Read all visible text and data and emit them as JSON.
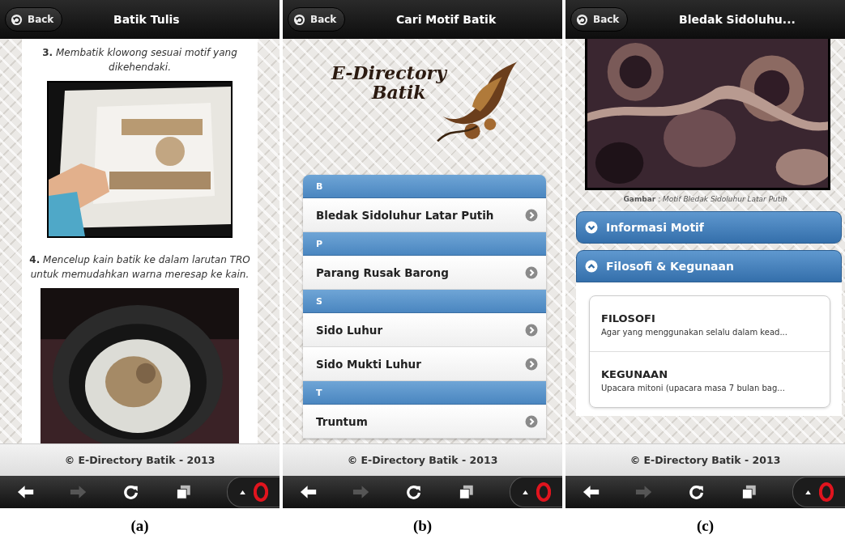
{
  "screens": [
    {
      "kind": "steps",
      "header": {
        "back": "Back",
        "title": "Batik Tulis"
      },
      "steps": [
        {
          "text": "**3.** *Membatik klowong sesuai motif yang dikehendaki.*",
          "picture": {
            "kind": "picture"
          }
        },
        {
          "text": "**4.** *Mencelup kain batik ke dalam larutan TRO untuk memudahkan warna meresap ke kain.*",
          "picture": {
            "kind": "picture"
          }
        }
      ],
      "footer": "© E-Directory Batik - 2013",
      "browser_bar": {
        "forward_disabled": true
      },
      "caption": "(a)"
    },
    {
      "kind": "list",
      "header": {
        "back": "Back",
        "title": "Cari Motif Batik"
      },
      "logo": {
        "line_1": "E-Directory",
        "line_2": "Batik"
      },
      "groups": [
        {
          "letter": "B",
          "items": [
            "Bledak Sidoluhur Latar Putih"
          ]
        },
        {
          "letter": "P",
          "items": [
            "Parang Rusak Barong"
          ]
        },
        {
          "letter": "S",
          "items": [
            "Sido Luhur",
            "Sido Mukti Luhur"
          ]
        },
        {
          "letter": "T",
          "items": [
            "Truntum"
          ]
        }
      ],
      "footer": "© E-Directory Batik - 2013",
      "browser_bar": {
        "forward_disabled": true
      },
      "caption": "(b)"
    },
    {
      "kind": "detail",
      "header": {
        "back": "Back",
        "title": "Bledak Sidoluhu..."
      },
      "picture": {
        "kind": "picture"
      },
      "picture_caption": "**Gambar** : *Motif Bledak Sidoluhur Latar Putih*",
      "sections": [
        {
          "title": "Informasi Motif",
          "expanded": false
        },
        {
          "title": "Filosofi & Kegunaan",
          "expanded": true,
          "entries": [
            {
              "heading": "FILOSOFI",
              "text": "Agar yang menggunakan selalu dalam kead..."
            },
            {
              "heading": "KEGUNAAN",
              "text": "Upacara mitoni (upacara masa 7 bulan bag..."
            }
          ]
        }
      ],
      "footer": "© E-Directory Batik - 2013",
      "browser_bar": {
        "forward_disabled": true
      },
      "caption": "(c)"
    }
  ]
}
